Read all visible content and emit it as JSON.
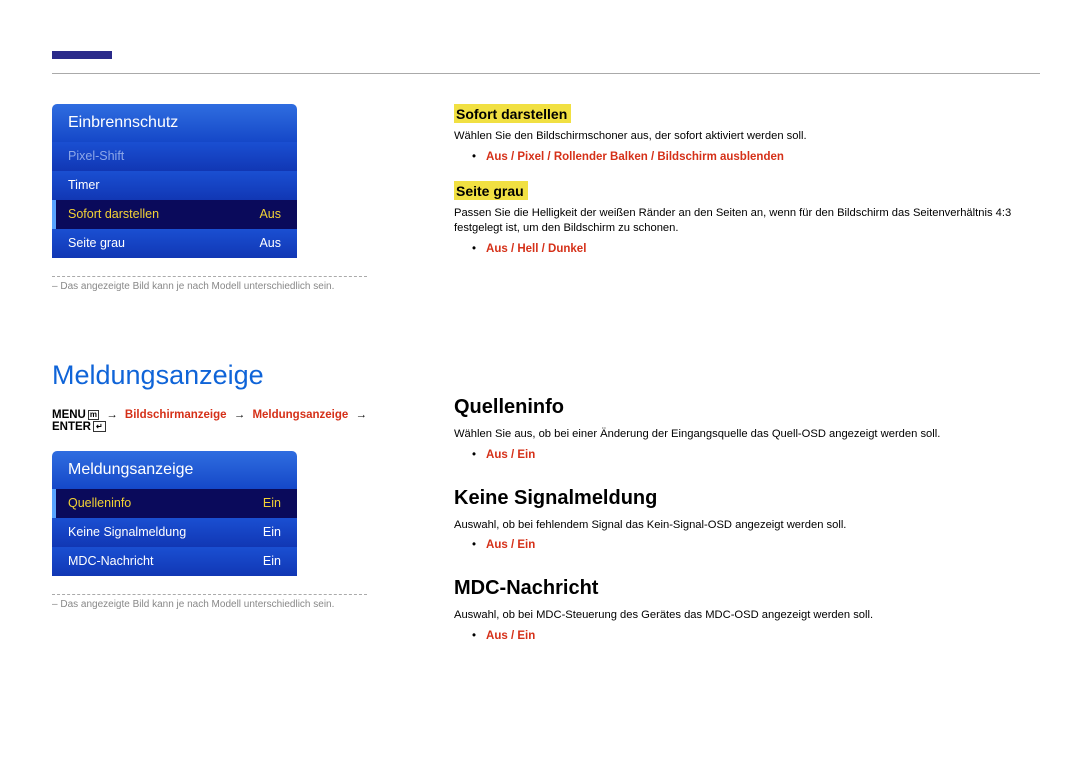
{
  "osd1": {
    "title": "Einbrennschutz",
    "rows": [
      {
        "label": "Pixel-Shift",
        "value": "",
        "dim": true,
        "selected": false
      },
      {
        "label": "Timer",
        "value": "",
        "dim": false,
        "selected": false
      },
      {
        "label": "Sofort darstellen",
        "value": "Aus",
        "dim": false,
        "selected": true
      },
      {
        "label": "Seite grau",
        "value": "Aus",
        "dim": false,
        "selected": false
      }
    ]
  },
  "note1": "Das angezeigte Bild kann je nach Modell unterschiedlich sein.",
  "section_heading": "Meldungsanzeige",
  "menupath": {
    "menu_label": "MENU",
    "crumbs": [
      "Bildschirmanzeige",
      "Meldungsanzeige"
    ],
    "enter_label": "ENTER"
  },
  "osd2": {
    "title": "Meldungsanzeige",
    "rows": [
      {
        "label": "Quelleninfo",
        "value": "Ein",
        "dim": false,
        "selected": true
      },
      {
        "label": "Keine Signalmeldung",
        "value": "Ein",
        "dim": false,
        "selected": false
      },
      {
        "label": "MDC-Nachricht",
        "value": "Ein",
        "dim": false,
        "selected": false
      }
    ]
  },
  "note2": "Das angezeigte Bild kann je nach Modell unterschiedlich sein.",
  "right_top": {
    "sofort": {
      "title": "Sofort darstellen",
      "desc": "Wählen Sie den Bildschirmschoner aus, der sofort aktiviert werden soll.",
      "options": [
        "Aus",
        "Pixel",
        "Rollender Balken",
        "Bildschirm ausblenden"
      ]
    },
    "seite": {
      "title": "Seite grau",
      "desc": "Passen Sie die Helligkeit der weißen Ränder an den Seiten an, wenn für den Bildschirm das Seitenverhältnis 4:3 festgelegt ist, um den Bildschirm zu schonen.",
      "options": [
        "Aus",
        "Hell",
        "Dunkel"
      ]
    }
  },
  "right_bottom": [
    {
      "title": "Quelleninfo",
      "desc": "Wählen Sie aus, ob bei einer Änderung der Eingangsquelle das Quell-OSD angezeigt werden soll.",
      "options": [
        "Aus",
        "Ein"
      ]
    },
    {
      "title": "Keine Signalmeldung",
      "desc": "Auswahl, ob bei fehlendem Signal das Kein-Signal-OSD angezeigt werden soll.",
      "options": [
        "Aus",
        "Ein"
      ]
    },
    {
      "title": "MDC-Nachricht",
      "desc": "Auswahl, ob bei MDC-Steuerung des Gerätes das MDC-OSD angezeigt werden soll.",
      "options": [
        "Aus",
        "Ein"
      ]
    }
  ]
}
